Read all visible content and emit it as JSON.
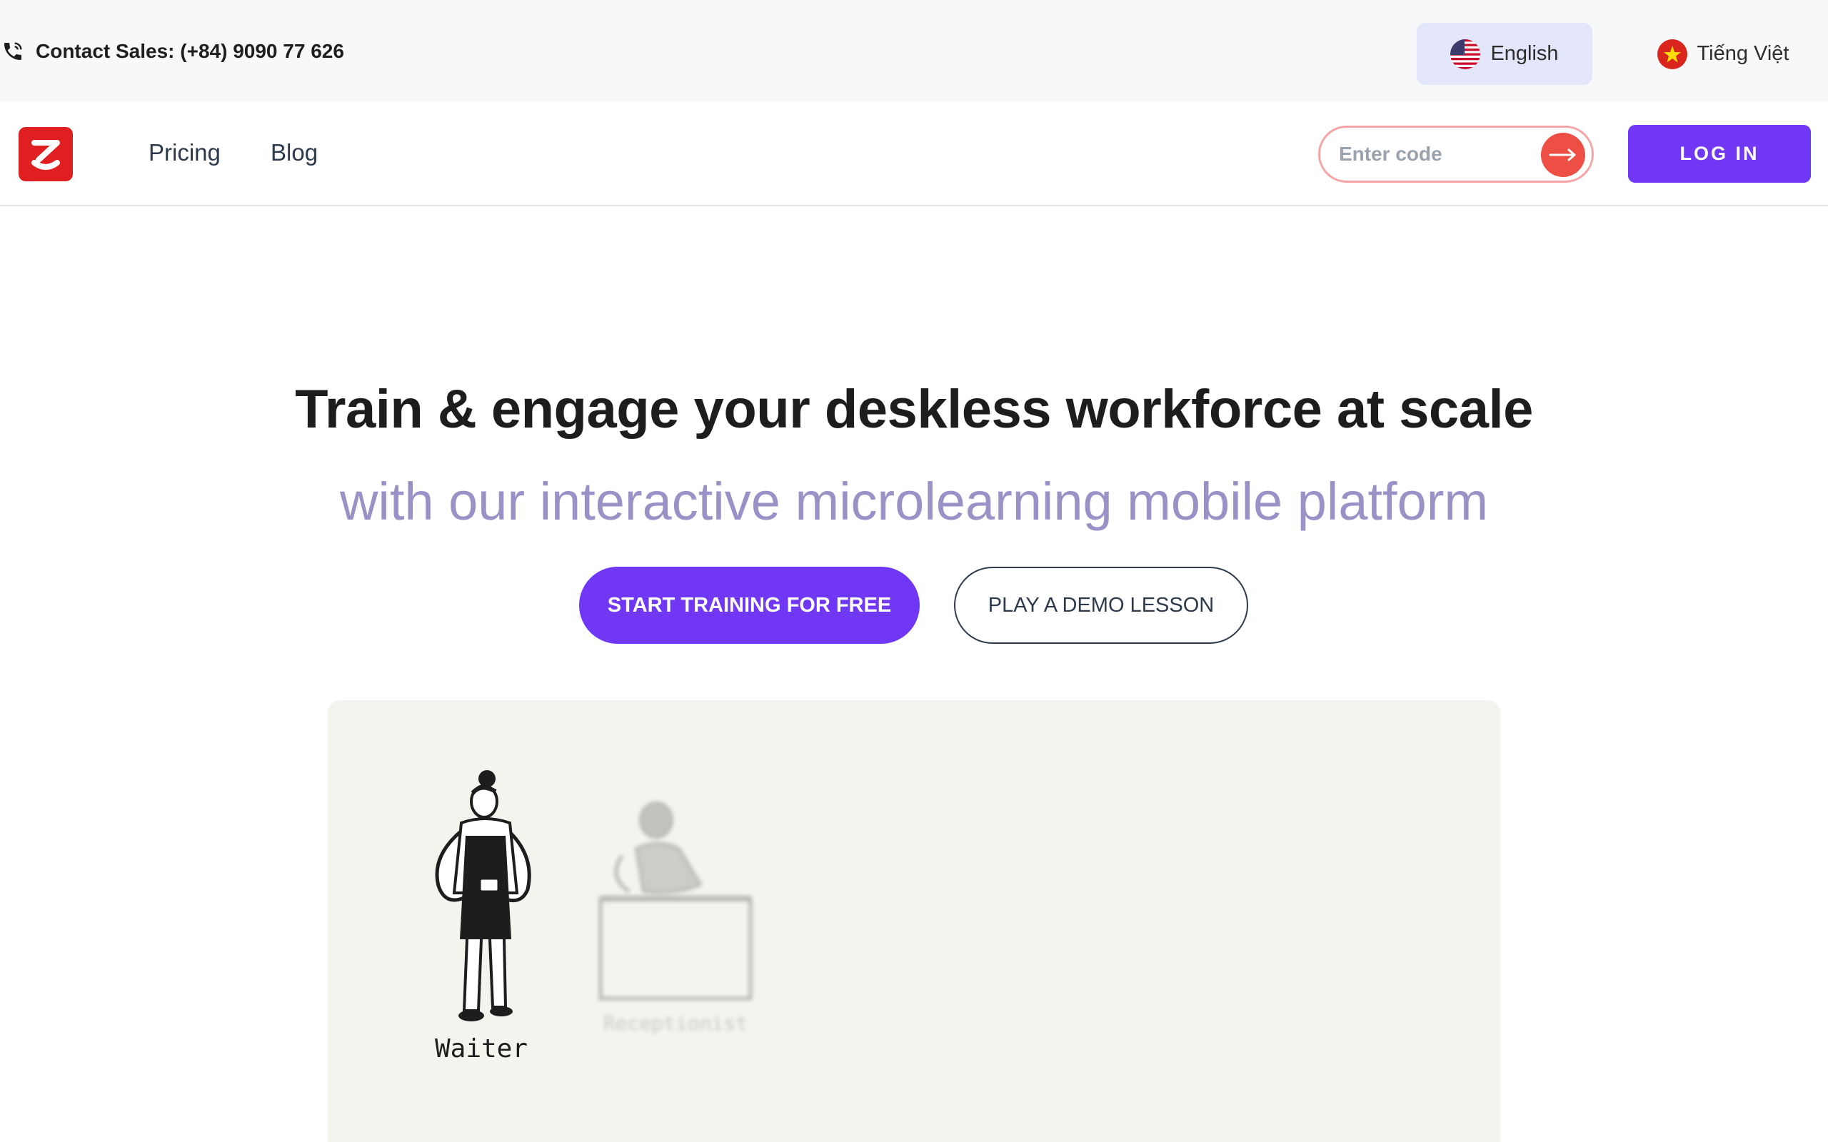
{
  "topbar": {
    "contact_label": "Contact Sales: (+84) 9090 77 626",
    "languages": [
      {
        "label": "English",
        "flag": "us-flag-icon",
        "active": true
      },
      {
        "label": "Tiếng Việt",
        "flag": "vn-flag-icon",
        "active": false
      }
    ]
  },
  "nav": {
    "logo": "z-logo-icon",
    "links": [
      "Pricing",
      "Blog"
    ],
    "code_input": {
      "value": "",
      "placeholder": "Enter code"
    },
    "login_label": "LOG IN"
  },
  "hero": {
    "title": "Train & engage your deskless workforce at scale",
    "subtitle": "with our interactive microlearning mobile platform",
    "primary_cta": "START TRAINING FOR FREE",
    "secondary_cta": "PLAY A DEMO LESSON"
  },
  "showcase": {
    "roles": [
      {
        "label": "Waiter",
        "active": true
      },
      {
        "label": "Receptionist",
        "active": false
      }
    ]
  },
  "colors": {
    "brand_purple": "#7038f5",
    "logo_red": "#e02020",
    "accent_red": "#ee4f44",
    "subtitle_lavender": "#9a92c7",
    "lang_active_bg": "#e4e7fb",
    "showcase_bg": "#f4f4ef"
  }
}
